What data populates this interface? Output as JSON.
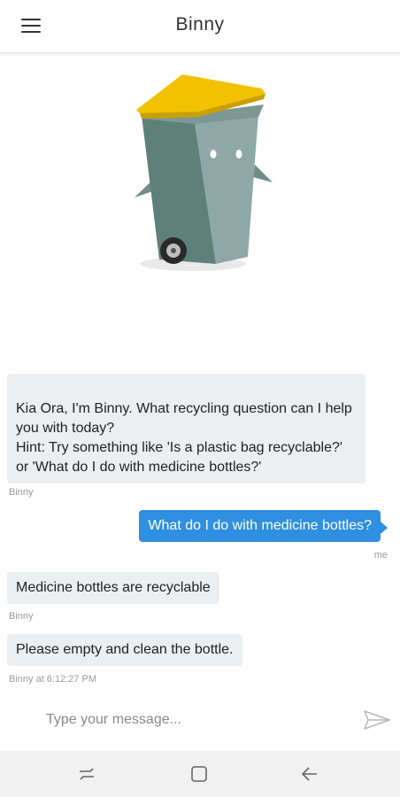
{
  "header": {
    "title": "Binny",
    "menu_icon": "hamburger-menu-icon"
  },
  "mascot": {
    "icon": "recycling-bin-mascot",
    "colors": {
      "lid": "#f2c200",
      "body": "#5e7f7a"
    }
  },
  "messages": [
    {
      "sender": "bot",
      "text": "Kia Ora, I'm Binny. What recycling question can I help you with today?\nHint: Try something like 'Is a plastic bag recyclable?' or 'What do I do with medicine bottles?'",
      "meta": "Binny"
    },
    {
      "sender": "me",
      "text": "What do I do with medicine bottles?",
      "meta": "me"
    },
    {
      "sender": "bot",
      "text": "Medicine bottles are recyclable",
      "meta": "Binny"
    },
    {
      "sender": "bot",
      "text": "Please empty and clean the bottle.",
      "meta": "Binny at 6:12:27 PM"
    }
  ],
  "composer": {
    "placeholder": "Type your message...",
    "send_icon": "send-icon"
  },
  "navbar": {
    "icons": [
      "recent-apps-icon",
      "home-icon",
      "back-icon"
    ]
  },
  "colors": {
    "accent": "#2f8fe0",
    "bot_bubble": "#eceff1",
    "meta_text": "#9a9a9a"
  }
}
